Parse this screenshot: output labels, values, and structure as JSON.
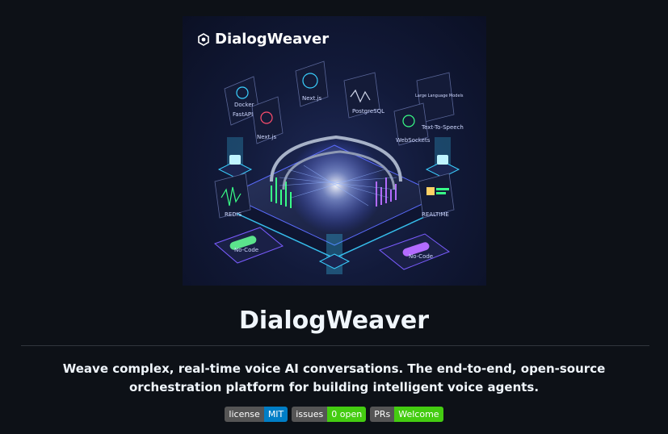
{
  "hero": {
    "brand": "DialogWeaver",
    "labels": {
      "docker": "Docker",
      "fastapi": "FastAPI",
      "nextjs_a": "Next.js",
      "nextjs_b": "Next.js",
      "postgres": "PostgreSQL",
      "llm": "Large Language Models",
      "tts": "Text-To-Speech",
      "websockets": "WebSockets",
      "redis": "REDIS",
      "realtime": "REALTIME",
      "nocode_a": "No-Code",
      "nocode_b": "No-Code"
    }
  },
  "title": "DialogWeaver",
  "tagline": "Weave complex, real-time voice AI conversations. The end-to-end, open-source orchestration platform for building intelligent voice agents.",
  "badges": [
    {
      "label": "license",
      "value": "MIT",
      "color": "#007ec6"
    },
    {
      "label": "issues",
      "value": "0 open",
      "color": "#44cc11"
    },
    {
      "label": "PRs",
      "value": "Welcome",
      "color": "#44cc11"
    }
  ]
}
